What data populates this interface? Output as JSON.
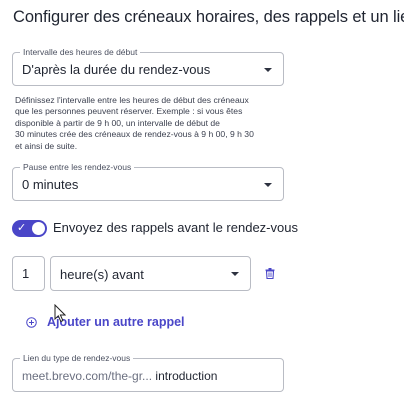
{
  "title": "Configurer des créneaux horaires, des rappels et un lien",
  "start_interval": {
    "label": "Intervalle des heures de début",
    "value": "D'après la durée du rendez-vous"
  },
  "helper_lines": [
    "Définissez l'intervalle entre les heures de début des créneaux",
    "que les personnes peuvent réserver. Exemple : si vous êtes",
    "disponible à partir de 9 h 00, un intervalle de début de",
    "30 minutes crée des créneaux de rendez-vous à 9 h 00, 9 h 30",
    "et ainsi de suite."
  ],
  "pause": {
    "label": "Pause entre les rendez-vous",
    "value": "0 minutes"
  },
  "reminders_toggle": {
    "label": "Envoyez des rappels avant le rendez-vous",
    "on": true
  },
  "reminder": {
    "amount": "1",
    "unit": "heure(s) avant"
  },
  "add_reminder_label": "Ajouter un autre rappel",
  "link": {
    "label": "Lien du type de rendez-vous",
    "prefix": "meet.brevo.com/the-gr...",
    "slug": "introduction"
  },
  "colors": {
    "accent": "#4a46c8"
  },
  "icons": {
    "caret": "chevron-down-icon",
    "check": "check-icon",
    "delete": "trash-icon",
    "add": "plus-circle-icon",
    "pointer": "mouse-cursor-icon"
  }
}
